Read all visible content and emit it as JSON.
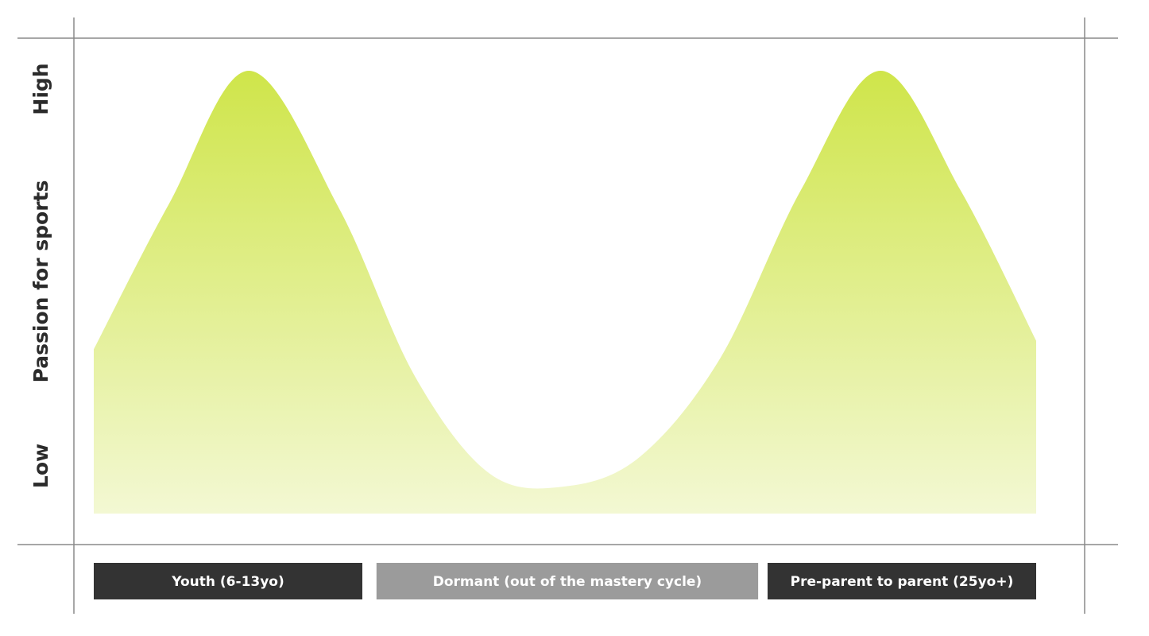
{
  "chart_data": {
    "type": "area",
    "title": "",
    "xlabel": "",
    "ylabel": "Passion for sports",
    "y_ticks": [
      "Low",
      "High"
    ],
    "ylim": [
      0,
      1
    ],
    "xlim": [
      0,
      1
    ],
    "grid": false,
    "legend": "none",
    "fill_color_top": "#cfe54a",
    "fill_color_bottom": "#f3f8d3",
    "series": [
      {
        "x": [
          0.0,
          0.08,
          0.165,
          0.26,
          0.34,
          0.42,
          0.5,
          0.58,
          0.665,
          0.75,
          0.835,
          0.92,
          1.0
        ],
        "values": [
          0.35,
          0.69,
          1.0,
          0.68,
          0.29,
          0.06,
          0.03,
          0.1,
          0.33,
          0.72,
          1.0,
          0.72,
          0.37
        ]
      }
    ],
    "phases": [
      {
        "label": "Youth (6-13yo)",
        "start": 0.0,
        "end": 0.285,
        "color": "#333333"
      },
      {
        "label": "Dormant (out of the mastery cycle)",
        "start": 0.3,
        "end": 0.705,
        "color": "#9b9b9b"
      },
      {
        "label": "Pre-parent to parent (25yo+)",
        "start": 0.715,
        "end": 1.0,
        "color": "#333333"
      }
    ]
  }
}
